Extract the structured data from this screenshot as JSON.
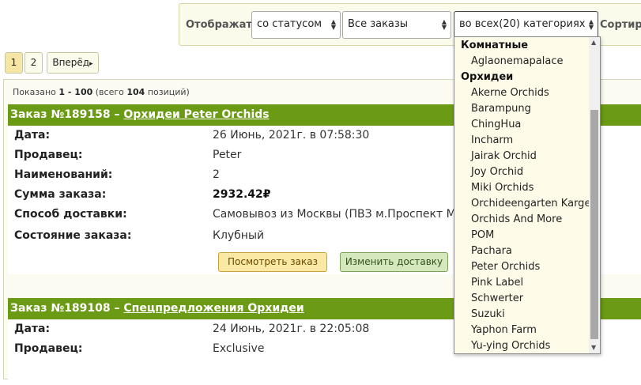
{
  "filter": {
    "show_label": "Отображать",
    "status_value": "со статусом",
    "orders_value": "Все заказы",
    "category_value": "во всех(20) категориях",
    "sort_label": "Сортир"
  },
  "pager": {
    "page1": "1",
    "page2": "2",
    "next": "Вперёд",
    "next_arrow": "▸"
  },
  "summary": {
    "prefix": "Показано",
    "range": "1 - 100",
    "total_prefix": "(всего",
    "total": "104",
    "total_suffix": "позиций)"
  },
  "orders": [
    {
      "title": "Заказ №189158 –",
      "link": "Орхидеи Peter Orchids",
      "rows": [
        {
          "label": "Дата:",
          "value": "26 Июнь, 2021г. в 07:58:30"
        },
        {
          "label": "Продавец:",
          "value": "Peter"
        },
        {
          "label": "Наименований:",
          "value": "2"
        },
        {
          "label": "Сумма заказа:",
          "value": "2932.42₽"
        },
        {
          "label": "Способ доставки:",
          "value": "Самовывоз из Москвы (ПВЗ м.Проспект Мир"
        },
        {
          "label": "Состояние заказа:",
          "value": "Клубный"
        }
      ],
      "view_button": "Посмотреть заказ",
      "ship_button": "Изменить доставку"
    },
    {
      "title": "Заказ №189108 –",
      "link": "Спецпредложения Орхидеи",
      "rows": [
        {
          "label": "Дата:",
          "value": "24 Июнь, 2021г. в 22:05:08"
        },
        {
          "label": "Продавец:",
          "value": "Exclusive"
        }
      ]
    }
  ],
  "category_dropdown": {
    "groups": [
      {
        "label": "Комнатные",
        "options": [
          "Aglaonemapalace"
        ]
      },
      {
        "label": "Орхидеи",
        "options": [
          "Akerne Orchids",
          "Barampung",
          "ChingHua",
          "Incharm",
          "Jairak Orchid",
          "Joy Orchid",
          "Miki Orchids",
          "Orchideengarten Karge",
          "Orchids And More",
          "POM",
          "Pachara",
          "Peter Orchids",
          "Pink Label",
          "Schwerter",
          "Suzuki",
          "Yaphon Farm",
          "Yu-ying Orchids"
        ]
      }
    ]
  },
  "colors": {
    "order_header": "#6b9a14",
    "filter_bg": "#fbfbec",
    "dropdown_bg": "#fffbe9"
  }
}
